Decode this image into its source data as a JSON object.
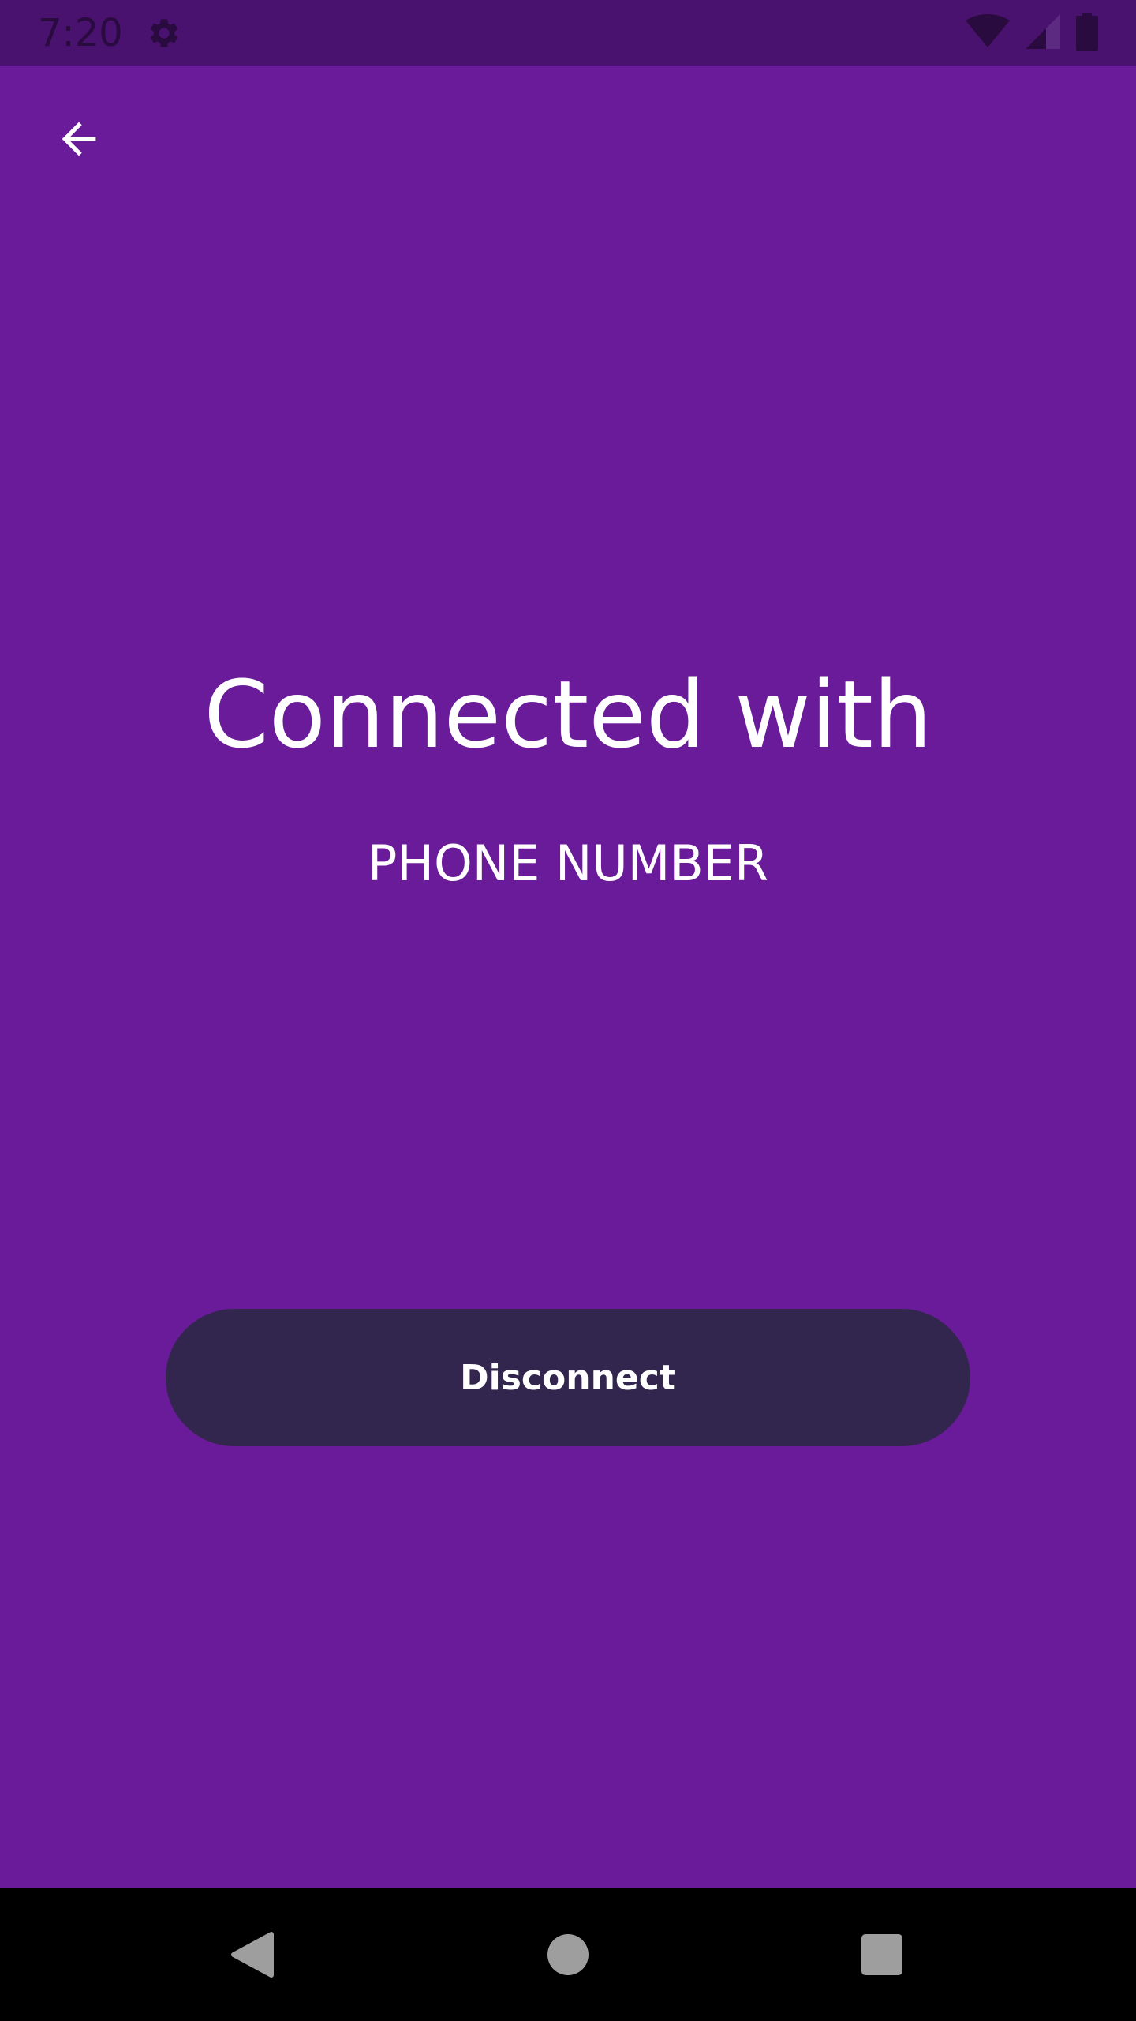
{
  "status_bar": {
    "time": "7:20",
    "icons": [
      "gear-icon",
      "wifi-icon",
      "signal-icon",
      "battery-icon"
    ]
  },
  "app_bar": {
    "back_icon": "arrow-back-icon"
  },
  "main": {
    "title": "Connected with",
    "subtitle": "PHONE NUMBER",
    "disconnect_label": "Disconnect"
  },
  "nav_bar": {
    "icons": [
      "nav-back-icon",
      "nav-home-icon",
      "nav-recents-icon"
    ]
  },
  "colors": {
    "background": "#6a1b9a",
    "status_bar": "#4a126f",
    "button": "#33264e",
    "text": "#ffffff"
  }
}
